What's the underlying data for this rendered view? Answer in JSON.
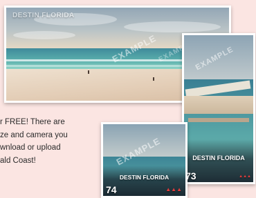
{
  "promo": {
    "lines": [
      "r FREE! There are",
      "ze and camera you",
      "wnload or upload",
      "ald Coast!"
    ]
  },
  "screenshots": {
    "large": {
      "location_name": "DESTIN FLORIDA",
      "watermark": "EXAMPLE",
      "watermark_secondary": "EXAMPLE"
    },
    "tall": {
      "location_name": "DESTIN FLORIDA",
      "temperature": "73",
      "watermark": "EXAMPLE"
    },
    "small": {
      "location_name": "DESTIN FLORIDA",
      "temperature": "74",
      "watermark": "EXAMPLE"
    }
  },
  "colors": {
    "background": "#fbe5e2",
    "logo": "#e23b3b"
  }
}
